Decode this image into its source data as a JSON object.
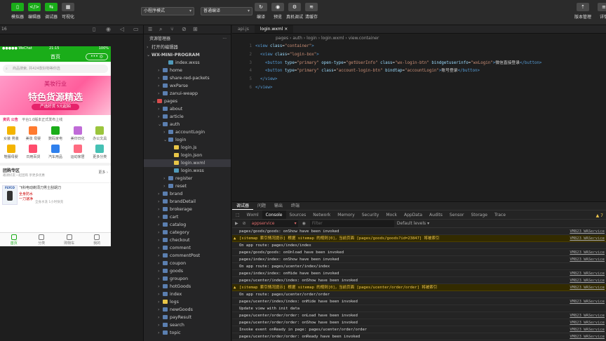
{
  "toolbar": {
    "left_buttons": [
      {
        "label": "模拟器",
        "glyph": "▯"
      },
      {
        "label": "编辑器",
        "glyph": "</>"
      },
      {
        "label": "调试器",
        "glyph": "⇆"
      },
      {
        "label": "可视化",
        "glyph": "▦"
      }
    ],
    "mode_select": "小程序模式",
    "compile_select": "普通编译",
    "center_buttons": [
      {
        "label": "编译",
        "glyph": "↻"
      },
      {
        "label": "预览",
        "glyph": "◉"
      },
      {
        "label": "真机调试",
        "glyph": "⚙"
      },
      {
        "label": "清缓存",
        "glyph": "≋"
      }
    ],
    "right_buttons": [
      {
        "label": "版本管理",
        "glyph": "⇡"
      },
      {
        "label": "详情",
        "glyph": "≡"
      }
    ]
  },
  "simulator": {
    "zoom": "16",
    "status_left": "●●●●● WeChat",
    "status_time": "21:15",
    "status_right": "100%",
    "nav_title": "首页",
    "capsule": "••• ◎",
    "search_placeholder": "商品搜索, 共424款好物等你选",
    "banner": {
      "line1": "美妆行业",
      "line2": "特色货源精选",
      "line3": "严选好货 5元起拍"
    },
    "notice_title": "资讯 公告",
    "notice_text": "平台1.0版本正式发布上线",
    "grid": [
      {
        "label": "女装 男装",
        "color": "#f4b400"
      },
      {
        "label": "美妆 母婴",
        "color": "#ff7a2f"
      },
      {
        "label": "数码家电",
        "color": "#1aad19"
      },
      {
        "label": "美印日化",
        "color": "#c06bd8"
      },
      {
        "label": "办公文具",
        "color": "#9bc53d"
      },
      {
        "label": "鞋服母婴",
        "color": "#f4b400"
      },
      {
        "label": "日用百货",
        "color": "#ff4d6d"
      },
      {
        "label": "汽车用品",
        "color": "#2f80ed"
      },
      {
        "label": "运动家居",
        "color": "#ff6b81"
      },
      {
        "label": "更多分类",
        "color": "#45c1b4"
      }
    ],
    "group_title": "团购专区",
    "group_sub": "邀请好友一起团购 享更多优惠",
    "group_more": "更多 ›",
    "product_title": "飞科电动剃须刀男士刮胡刀",
    "product_sub": "全身水洗 1小时快充",
    "product_tags": [
      "全身防水",
      "一刀速净"
    ],
    "product_brand": "FLYCO",
    "tabs": [
      "首页",
      "分类",
      "购物车",
      "我的"
    ],
    "active_tab": 0
  },
  "explorer": {
    "title": "资源管理器",
    "open_editors": "打开的编辑器",
    "project": "WX-MINI-PROGRAM",
    "items": [
      {
        "name": "index.wxss",
        "indent": 3,
        "arrow": "",
        "icon": "#519aba"
      },
      {
        "name": "home",
        "indent": 2,
        "arrow": "›",
        "icon": "#5b7fb0"
      },
      {
        "name": "share-red-packets",
        "indent": 2,
        "arrow": "›",
        "icon": "#5b7fb0"
      },
      {
        "name": "wxParse",
        "indent": 2,
        "arrow": "›",
        "icon": "#5b7fb0"
      },
      {
        "name": "zanui-weapp",
        "indent": 2,
        "arrow": "›",
        "icon": "#5b7fb0"
      },
      {
        "name": "pages",
        "indent": 1,
        "arrow": "⌄",
        "icon": "#d94c4c"
      },
      {
        "name": "about",
        "indent": 2,
        "arrow": "›",
        "icon": "#5b7fb0"
      },
      {
        "name": "article",
        "indent": 2,
        "arrow": "›",
        "icon": "#5b7fb0"
      },
      {
        "name": "auth",
        "indent": 2,
        "arrow": "⌄",
        "icon": "#5b7fb0"
      },
      {
        "name": "accountLogin",
        "indent": 3,
        "arrow": "›",
        "icon": "#5b7fb0"
      },
      {
        "name": "login",
        "indent": 3,
        "arrow": "⌄",
        "icon": "#5b7fb0"
      },
      {
        "name": "login.js",
        "indent": 4,
        "arrow": "",
        "icon": "#e8c547"
      },
      {
        "name": "login.json",
        "indent": 4,
        "arrow": "",
        "icon": "#e8c547"
      },
      {
        "name": "login.wxml",
        "indent": 4,
        "arrow": "",
        "icon": "#e8c547",
        "selected": true
      },
      {
        "name": "login.wxss",
        "indent": 4,
        "arrow": "",
        "icon": "#519aba"
      },
      {
        "name": "register",
        "indent": 3,
        "arrow": "›",
        "icon": "#5b7fb0"
      },
      {
        "name": "reset",
        "indent": 3,
        "arrow": "›",
        "icon": "#5b7fb0"
      },
      {
        "name": "brand",
        "indent": 2,
        "arrow": "›",
        "icon": "#5b7fb0"
      },
      {
        "name": "brandDetail",
        "indent": 2,
        "arrow": "›",
        "icon": "#5b7fb0"
      },
      {
        "name": "brokerage",
        "indent": 2,
        "arrow": "›",
        "icon": "#5b7fb0"
      },
      {
        "name": "cart",
        "indent": 2,
        "arrow": "›",
        "icon": "#5b7fb0"
      },
      {
        "name": "catalog",
        "indent": 2,
        "arrow": "›",
        "icon": "#5b7fb0"
      },
      {
        "name": "category",
        "indent": 2,
        "arrow": "›",
        "icon": "#5b7fb0"
      },
      {
        "name": "checkout",
        "indent": 2,
        "arrow": "›",
        "icon": "#5b7fb0"
      },
      {
        "name": "comment",
        "indent": 2,
        "arrow": "›",
        "icon": "#5b7fb0"
      },
      {
        "name": "commentPost",
        "indent": 2,
        "arrow": "›",
        "icon": "#5b7fb0"
      },
      {
        "name": "coupon",
        "indent": 2,
        "arrow": "›",
        "icon": "#5b7fb0"
      },
      {
        "name": "goods",
        "indent": 2,
        "arrow": "›",
        "icon": "#5b7fb0"
      },
      {
        "name": "groupon",
        "indent": 2,
        "arrow": "›",
        "icon": "#5b7fb0"
      },
      {
        "name": "hotGoods",
        "indent": 2,
        "arrow": "›",
        "icon": "#5b7fb0"
      },
      {
        "name": "index",
        "indent": 2,
        "arrow": "›",
        "icon": "#5b7fb0"
      },
      {
        "name": "logs",
        "indent": 2,
        "arrow": "›",
        "icon": "#e8c547"
      },
      {
        "name": "newGoods",
        "indent": 2,
        "arrow": "›",
        "icon": "#5b7fb0"
      },
      {
        "name": "payResult",
        "indent": 2,
        "arrow": "›",
        "icon": "#5b7fb0"
      },
      {
        "name": "search",
        "indent": 2,
        "arrow": "›",
        "icon": "#5b7fb0"
      },
      {
        "name": "topic",
        "indent": 2,
        "arrow": "›",
        "icon": "#5b7fb0"
      }
    ]
  },
  "editor": {
    "tabs": [
      {
        "name": "api.js",
        "active": false
      },
      {
        "name": "login.wxml",
        "active": true
      }
    ],
    "breadcrumb": "pages › auth › login › login.wxml › view.container",
    "lines": [
      {
        "n": "1",
        "html": "<span class='tg'>&lt;view</span> <span class='at'>class</span>=<span class='st'>\"container\"</span><span class='tg'>&gt;</span>"
      },
      {
        "n": "2",
        "html": "  <span class='tg'>&lt;view</span> <span class='at'>class</span>=<span class='st'>\"login-box\"</span><span class='tg'>&gt;</span>"
      },
      {
        "n": "3",
        "html": "    <span class='tg'>&lt;button</span> <span class='at'>type</span>=<span class='st'>\"primary\"</span> <span class='at'>open-type</span>=<span class='st'>\"getUserInfo\"</span> <span class='at'>class</span>=<span class='st'>\"wx-login-btn\"</span> <span class='at'>bindgetuserinfo</span>=<span class='st'>\"wxLogin\"</span><span class='tg'>&gt;</span>微信直接登录<span class='tg'>&lt;/button&gt;</span>"
      },
      {
        "n": "4",
        "html": "    <span class='tg'>&lt;button</span> <span class='at'>type</span>=<span class='st'>\"primary\"</span> <span class='at'>class</span>=<span class='st'>\"account-login-btn\"</span> <span class='at'>bindtap</span>=<span class='st'>\"accountLogin\"</span><span class='tg'>&gt;</span>账号登录<span class='tg'>&lt;/button&gt;</span>"
      },
      {
        "n": "5",
        "html": "  <span class='tg'>&lt;/view&gt;</span>"
      },
      {
        "n": "6",
        "html": "<span class='tg'>&lt;/view&gt;</span>"
      }
    ]
  },
  "devtools": {
    "top_tabs": [
      "调试器",
      "问题",
      "输出",
      "终端"
    ],
    "active_top": 0,
    "panel_tabs": [
      "Wxml",
      "Console",
      "Sources",
      "Network",
      "Memory",
      "Security",
      "Mock",
      "AppData",
      "Audits",
      "Sensor",
      "Storage",
      "Trace"
    ],
    "active_panel": 1,
    "context": "appservice",
    "filter_placeholder": "Filter",
    "levels": "Default levels",
    "warning_count": "7",
    "logs": [
      {
        "text": "pages/goods/goods: onShow have been invoked",
        "src": "VM823_WAService",
        "warn": false
      },
      {
        "text": "[sitemap 索引情况提示] 根据 sitemap 的规则[0]，当前页面 [pages/goods/goods?id=23847] 将被索引",
        "src": "VM823_WAService",
        "warn": true
      },
      {
        "text": "On app route: pages/index/index",
        "src": "",
        "warn": false
      },
      {
        "text": "pages/goods/goods: onUnload have been invoked",
        "src": "VM823_WAService",
        "warn": false
      },
      {
        "text": "pages/index/index: onShow have been invoked",
        "src": "VM823_WAService",
        "warn": false
      },
      {
        "text": "On app route: pages/ucenter/index/index",
        "src": "",
        "warn": false
      },
      {
        "text": "pages/index/index: onHide have been invoked",
        "src": "VM823_WAService",
        "warn": false
      },
      {
        "text": "pages/ucenter/index/index: onShow have been invoked",
        "src": "VM823_WAService",
        "warn": false
      },
      {
        "text": "[sitemap 索引情况提示] 根据 sitemap 的规则[0]，当前页面 [pages/ucenter/order/order] 将被索引",
        "src": "VM823_WAService",
        "warn": true
      },
      {
        "text": "On app route: pages/ucenter/order/order",
        "src": "",
        "warn": false
      },
      {
        "text": "pages/ucenter/index/index: onHide have been invoked",
        "src": "VM823_WAService",
        "warn": false
      },
      {
        "text": "Update view with init data",
        "src": "",
        "warn": false
      },
      {
        "text": "pages/ucenter/order/order: onLoad have been invoked",
        "src": "VM823_WAService",
        "warn": false
      },
      {
        "text": "pages/ucenter/order/order: onShow have been invoked",
        "src": "VM823_WAService",
        "warn": false
      },
      {
        "text": "Invoke event onReady in page: pages/ucenter/order/order",
        "src": "VM823_WAService",
        "warn": false
      },
      {
        "text": "pages/ucenter/order/order: onReady have been invoked",
        "src": "VM823_WAService",
        "warn": false
      }
    ]
  }
}
